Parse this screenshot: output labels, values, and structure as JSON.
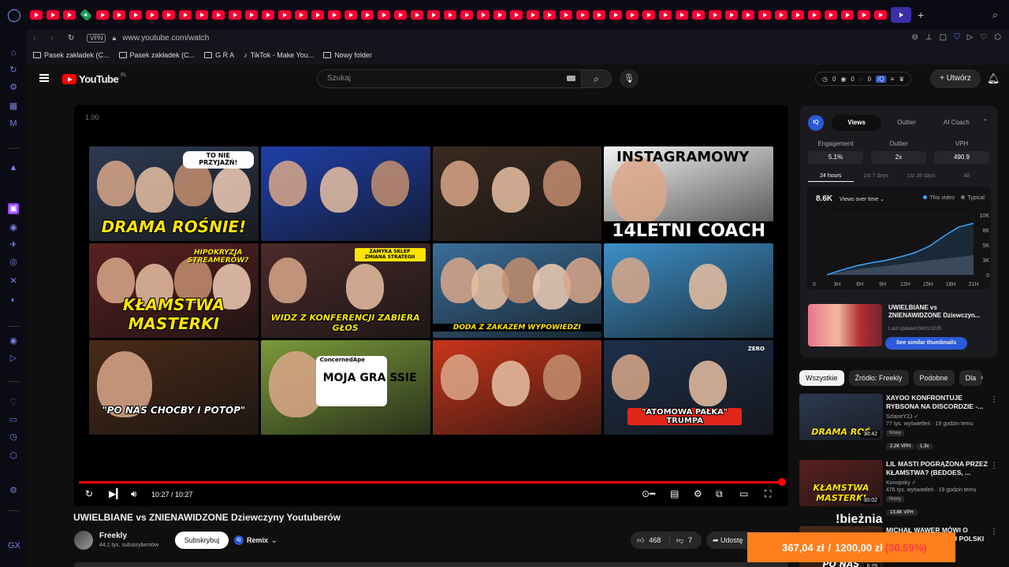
{
  "browser": {
    "address": {
      "vpn": "VPN",
      "url": "www.youtube.com/watch"
    },
    "bookmarks": [
      "Pasek zakładek (C...",
      "Pasek zakładek (C...",
      "G R A",
      "TikTok - Make You...",
      "Nowy folder"
    ],
    "sidebar_icons": [
      "opera-sidebar-icon",
      "history-icon",
      "bot-icon",
      "chat-icon",
      "mail-icon",
      "arrow-icon",
      "twitch-icon",
      "messenger-icon",
      "telegram-icon",
      "instagram-icon",
      "x-icon",
      "discord-icon",
      "player-icon",
      "send-icon",
      "heart-icon",
      "wallet-icon",
      "clock-icon",
      "puzzle-icon",
      "settings-icon",
      "more-icon",
      "gx-icon"
    ]
  },
  "youtube": {
    "logo_text": "YouTube",
    "region": "PL",
    "search_placeholder": "Szukaj",
    "extension_stats": [
      "0",
      "0",
      "0"
    ],
    "create_label": "Utwórz"
  },
  "player": {
    "speed": "1.00",
    "time": "10:27 / 10:27",
    "progress": 1.0,
    "thumbnails": [
      {
        "caption": "DRAMA ROŚNIE!",
        "bubble": "TO NIE PRZYJAŹŃ!",
        "bg": "#2d3a52",
        "accent": "#ffe600"
      },
      {
        "caption": "",
        "bubble": "",
        "bg": "#1f3fa8",
        "accent": "#ffffff"
      },
      {
        "caption": "",
        "bubble": "",
        "bg": "#3a2a20",
        "accent": "#ffffff"
      },
      {
        "caption": "14LETNI COACH",
        "bubble": "INSTAGRAMOWY",
        "bg": "#f4f4f4",
        "accent": "#ffffff"
      },
      {
        "caption": "KŁAMSTWA MASTERKI",
        "bubble": "HIPOKRYZJA STREAMERÓW?",
        "bg": "#5a2020",
        "accent": "#ffe600"
      },
      {
        "caption": "WIDZ Z KONFERENCJI ZABIERA GŁOS",
        "bubble": "ZAMYKA SKLEP ZMIANA STRATEGII",
        "bg": "#4b2a2a",
        "accent": "#ffe600"
      },
      {
        "caption": "DODA Z ZAKAZEM WYPOWIEDZI",
        "bubble": "",
        "bg": "#3a6e9a",
        "accent": "#ffe600"
      },
      {
        "caption": "",
        "bubble": "",
        "bg": "#3d8fc7",
        "accent": "#ffffff"
      },
      {
        "caption": "\"PO NAS CHOCBY I POTOP\"",
        "bubble": "",
        "bg": "#4a2a18",
        "accent": "#ff2d2d"
      },
      {
        "caption": "MOJA GRA SSIE",
        "bubble": "ConcernedApe",
        "bg": "#7a9a3a",
        "accent": "#000000"
      },
      {
        "caption": "",
        "bubble": "",
        "bg": "#c8351a",
        "accent": "#ffffff"
      },
      {
        "caption": "\"ATOMOWA PAŁKA\" TRUMPA",
        "bubble": "ZERO",
        "bg": "#1e2f4a",
        "accent": "#ffffff"
      }
    ]
  },
  "video": {
    "title": "UWIELBIANE vs ZNIENAWIDZONE Dziewczyny Youtuberów",
    "channel": "Freekly",
    "subscribers": "44,1 tys. subskrybentów",
    "subscribe_label": "Subskrybuj",
    "remix_label": "Remix",
    "likes": "468",
    "dislikes": "7",
    "share_label": "Udostę"
  },
  "overlay": {
    "label": "!bieżnia",
    "current": "367,04 zł",
    "slash": "/",
    "goal": "1200,00 zł",
    "percent": "(30.59%)"
  },
  "vidiq": {
    "logo": "IQ",
    "tabs": [
      "Views",
      "Outlier",
      "AI Coach"
    ],
    "active_tab": 0,
    "metrics": [
      {
        "label": "Engagement",
        "value": "5.1%"
      },
      {
        "label": "Outlier",
        "value": "2x"
      },
      {
        "label": "VPH",
        "value": "490.9"
      }
    ],
    "ranges": [
      "24 hours",
      "1st 7 days",
      "1st 28 days",
      "All"
    ],
    "views_total": "8.6K",
    "views_label": "Views over time",
    "legend": [
      {
        "name": "This video",
        "color": "#3ea6ff"
      },
      {
        "name": "Typical",
        "color": "#777777"
      }
    ],
    "chart_data": {
      "type": "area",
      "x": [
        "0",
        "3H",
        "6H",
        "9H",
        "12H",
        "15H",
        "18H",
        "21H"
      ],
      "xticks": [
        "0",
        "3H",
        "6H",
        "9H",
        "12H",
        "15H",
        "18H",
        "21H"
      ],
      "ylim": [
        0,
        10000
      ],
      "yticks": [
        "10K",
        "8K",
        "5K",
        "3K",
        "0"
      ],
      "series": [
        {
          "name": "This video",
          "color": "#3ea6ff",
          "values": [
            0,
            800,
            1500,
            2000,
            2400,
            3000,
            3700,
            4800,
            6500,
            8000,
            8600
          ]
        },
        {
          "name": "Typical",
          "color": "#555555",
          "values": [
            0,
            500,
            900,
            1200,
            1500,
            1800,
            2100,
            2400,
            2700,
            3000,
            3300
          ]
        }
      ]
    },
    "video_title": "UWIELBIANE vs ZNIENAWIDZONE Dziewczyn...",
    "updated": "Last Updated 08/01/2025",
    "similar_label": "See similar thumbnails"
  },
  "chips": [
    {
      "label": "Wszystkie",
      "active": true
    },
    {
      "label": "Źródło: Freekly",
      "active": false
    },
    {
      "label": "Podobne",
      "active": false
    },
    {
      "label": "Dla",
      "active": false
    }
  ],
  "recommendations": [
    {
      "title": "XAYOO KONFRONTUJE RYBSONA NA DISCORDZIE -...",
      "channel": "SzlaneY2J",
      "meta": "77 tys. wyświetleń · 19 godzin temu",
      "badge": "Nowy",
      "vph": "2.2K VPH",
      "ratio": "1.3x",
      "duration": "30:42",
      "thumb_caption": "DRAMA ROŚ",
      "thumb_bg": "#2d3a52",
      "thumb_accent": "#ffe600"
    },
    {
      "title": "LIL MASTI POGRĄŻONA PRZEZ KŁAMSTWA? (BEDOES, ...",
      "channel": "Konopsky",
      "meta": "476 tys. wyświetleń · 19 godzin temu",
      "badge": "Nowy",
      "vph": "13.8K VPH",
      "ratio": "",
      "duration": "30:02",
      "thumb_caption": "KŁAMSTWA MASTERKI",
      "thumb_bg": "#5a2020",
      "thumb_accent": "#ffe600"
    },
    {
      "title": "MICHAŁ WAWER MÓWI O PATOLOGII DEFICYTU POLSKI ...",
      "channel": "",
      "meta": "",
      "badge": "",
      "vph": "",
      "ratio": "",
      "duration": "6:29",
      "thumb_caption": "PO NAS",
      "thumb_bg": "#4a2a18",
      "thumb_accent": "#ffffff"
    }
  ]
}
